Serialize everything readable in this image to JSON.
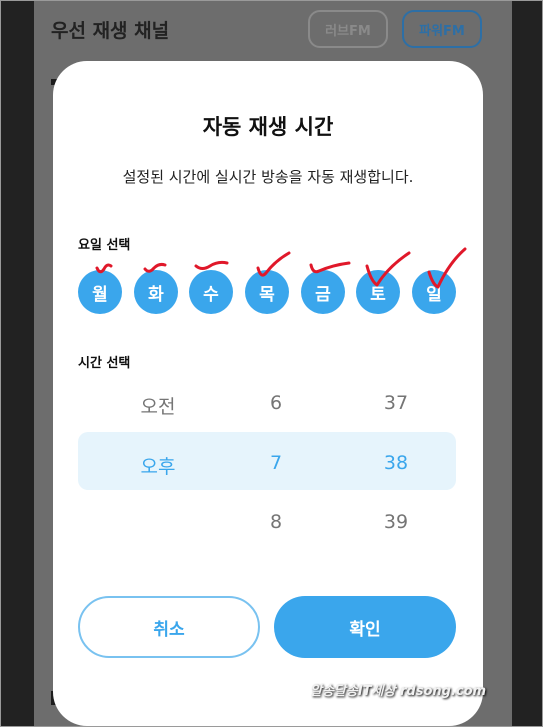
{
  "background": {
    "title": "우선 재생 채널",
    "chips": [
      {
        "label": "러브FM"
      },
      {
        "label": "파워FM"
      }
    ]
  },
  "dialog": {
    "title": "자동 재생 시간",
    "subtitle": "설정된 시간에 실시간 방송을 자동 재생합니다.",
    "day_section_label": "요일 선택",
    "days": [
      "월",
      "화",
      "수",
      "목",
      "금",
      "토",
      "일"
    ],
    "time_section_label": "시간 선택",
    "picker": {
      "ampm": [
        "오전",
        "오후"
      ],
      "hours": [
        "6",
        "7",
        "8"
      ],
      "minutes": [
        "37",
        "38",
        "39"
      ],
      "selected": {
        "ampm": "오후",
        "hour": "7",
        "minute": "38"
      }
    },
    "cancel_label": "취소",
    "confirm_label": "확인"
  },
  "colors": {
    "accent": "#3aa6ec",
    "highlight": "#e6f4fc",
    "annotation": "#e0182a"
  },
  "watermark": "알송달송IT세상 rdsong.com"
}
